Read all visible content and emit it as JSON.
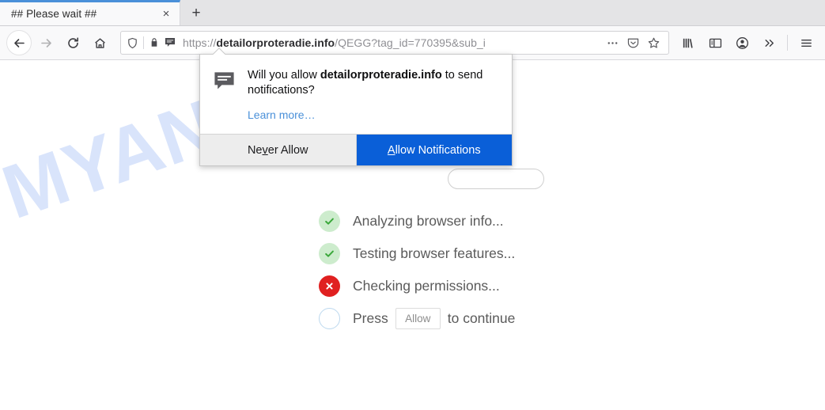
{
  "browser": {
    "tab": {
      "title": "## Please wait ##",
      "close_label": "×"
    },
    "newtab_label": "+",
    "nav": {
      "back": "back-arrow",
      "forward": "forward-arrow",
      "reload": "reload",
      "home": "home"
    },
    "urlbar": {
      "scheme": "https://",
      "host": "detailorproteradie.info",
      "path": "/QEGG?tag_id=770395&sub_i",
      "full_url": "https://detailorproteradie.info/QEGG?tag_id=770395&sub_i",
      "shield_icon": "tracking-protection-shield",
      "lock_icon": "padlock",
      "notification_icon": "notification-permission-bubble",
      "page_actions_icon": "ellipsis",
      "reader_icon": "pocket",
      "bookmark_icon": "star"
    },
    "toolbar": {
      "library_icon": "library",
      "sidebar_icon": "sidebar",
      "account_icon": "account",
      "overflow_icon": "chevrons-right",
      "menu_icon": "hamburger-menu"
    }
  },
  "doorhanger": {
    "icon": "notification-bubble-icon",
    "question_prefix": "Will you allow ",
    "question_host": "detailorproteradie.info",
    "question_suffix": " to send notifications?",
    "learn_more": "Learn more…",
    "never_allow": {
      "accesskey": "v",
      "before": "Ne",
      "after": "er Allow",
      "label": "Never Allow"
    },
    "allow": {
      "accesskey": "A",
      "before": "",
      "after": "llow Notifications",
      "label": "Allow Notifications"
    }
  },
  "page": {
    "watermark": "MYANTISPYWARE.COM",
    "watermark_color": "#d9e4fb",
    "checklist": [
      {
        "status": "ok",
        "icon": "green-check-icon",
        "label": "Analyzing browser info..."
      },
      {
        "status": "ok",
        "icon": "green-check-icon",
        "label": "Testing browser features..."
      },
      {
        "status": "err",
        "icon": "red-x-icon",
        "label": "Checking permissions..."
      },
      {
        "status": "pending",
        "icon": "empty-circle-icon",
        "label_before": "Press",
        "inline_button": "Allow",
        "label_after": "to continue"
      }
    ]
  },
  "colors": {
    "primary_button": "#0a5fd8",
    "link": "#4a90d9",
    "success": "#3aa83a",
    "error": "#e02020",
    "tab_accent": "#4a90d9"
  }
}
